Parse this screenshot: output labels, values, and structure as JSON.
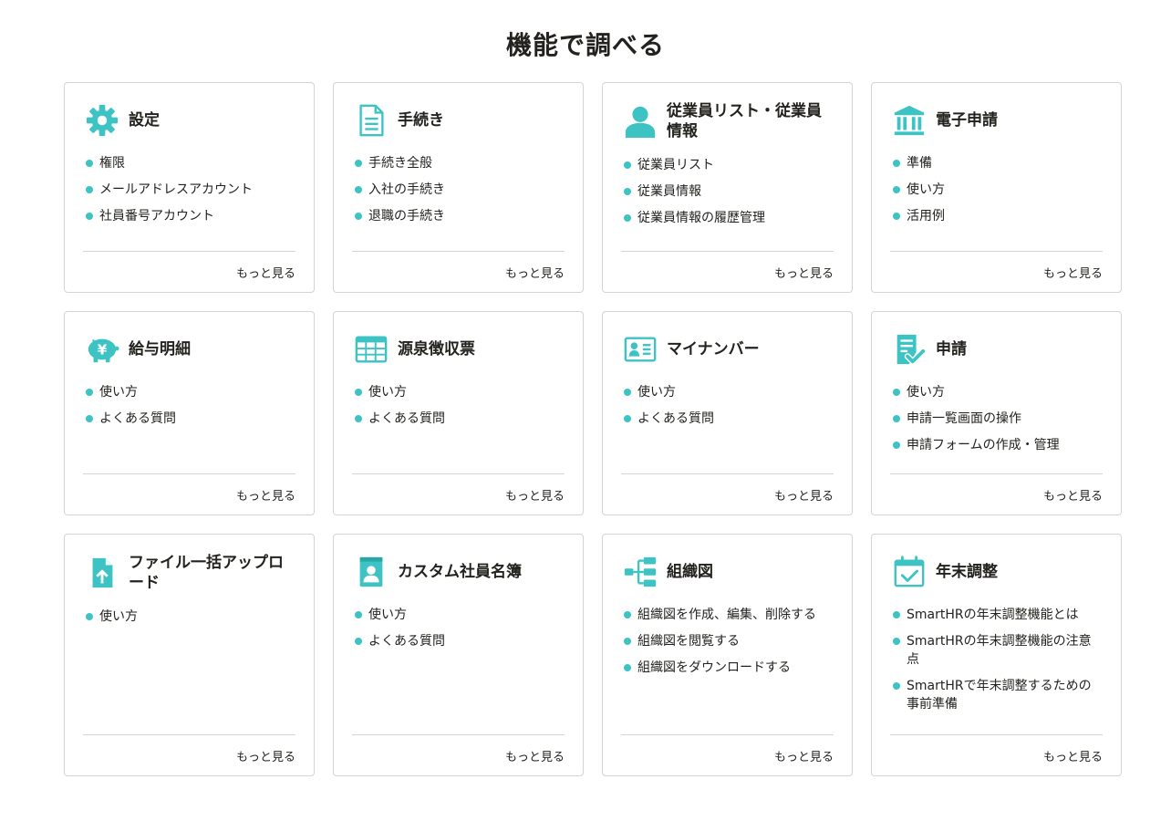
{
  "page": {
    "title": "機能で調べる"
  },
  "colors": {
    "accent": "#3dc3c4",
    "border": "#d6d3d0",
    "text": "#23221e"
  },
  "more_label": "もっと見る",
  "cards": [
    {
      "icon": "gear-icon",
      "title": "設定",
      "items": [
        "権限",
        "メールアドレスアカウント",
        "社員番号アカウント"
      ]
    },
    {
      "icon": "document-icon",
      "title": "手続き",
      "items": [
        "手続き全般",
        "入社の手続き",
        "退職の手続き"
      ]
    },
    {
      "icon": "person-icon",
      "title": "従業員リスト・従業員情報",
      "items": [
        "従業員リスト",
        "従業員情報",
        "従業員情報の履歴管理"
      ]
    },
    {
      "icon": "bank-icon",
      "title": "電子申請",
      "items": [
        "準備",
        "使い方",
        "活用例"
      ]
    },
    {
      "icon": "piggy-bank-yen-icon",
      "title": "給与明細",
      "items": [
        "使い方",
        "よくある質問"
      ]
    },
    {
      "icon": "table-sheet-icon",
      "title": "源泉徴収票",
      "items": [
        "使い方",
        "よくある質問"
      ]
    },
    {
      "icon": "id-card-icon",
      "title": "マイナンバー",
      "items": [
        "使い方",
        "よくある質問"
      ]
    },
    {
      "icon": "checklist-icon",
      "title": "申請",
      "items": [
        "使い方",
        "申請一覧画面の操作",
        "申請フォームの作成・管理"
      ]
    },
    {
      "icon": "file-upload-icon",
      "title": "ファイル一括アップロード",
      "items": [
        "使い方"
      ]
    },
    {
      "icon": "address-book-icon",
      "title": "カスタム社員名簿",
      "items": [
        "使い方",
        "よくある質問"
      ]
    },
    {
      "icon": "org-chart-icon",
      "title": "組織図",
      "items": [
        "組織図を作成、編集、削除する",
        "組織図を閲覧する",
        "組織図をダウンロードする"
      ]
    },
    {
      "icon": "calendar-check-icon",
      "title": "年末調整",
      "items": [
        "SmartHRの年末調整機能とは",
        "SmartHRの年末調整機能の注意点",
        "SmartHRで年末調整するための事前準備"
      ]
    }
  ]
}
